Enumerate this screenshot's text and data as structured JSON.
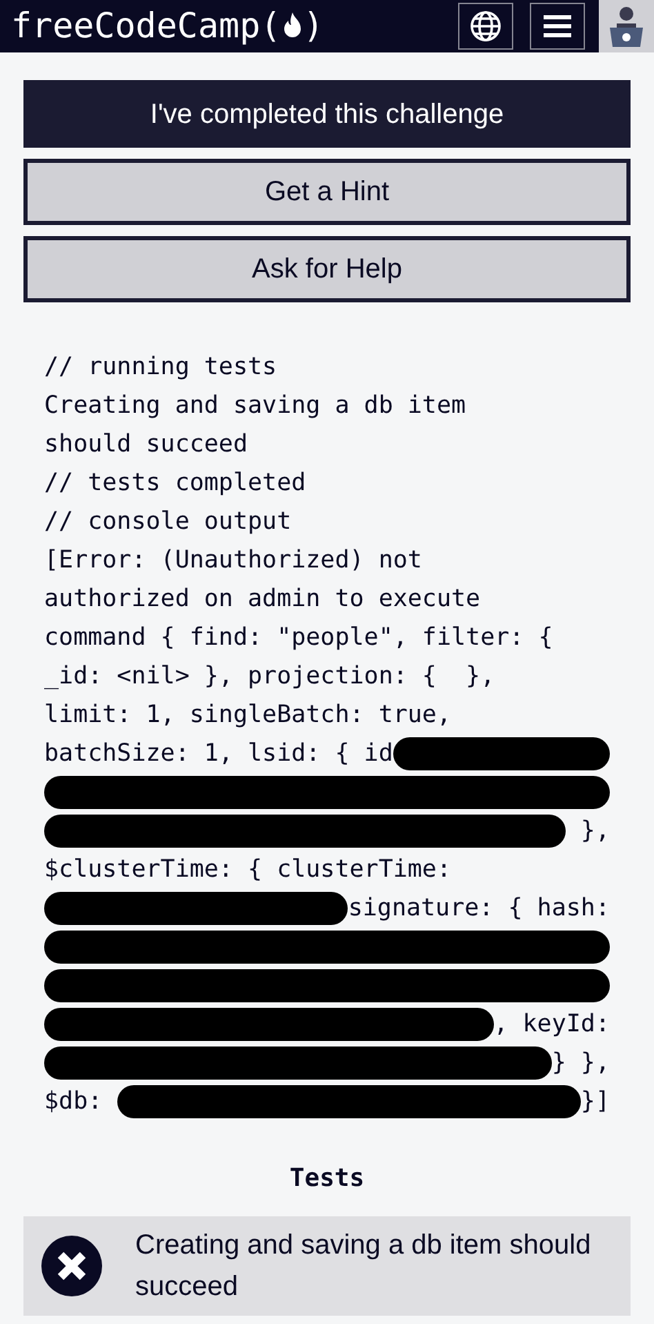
{
  "header": {
    "logo_before": "freeCodeCamp(",
    "logo_after": ")"
  },
  "actions": [
    {
      "label": "I've completed this challenge",
      "kind": "primary"
    },
    {
      "label": "Get a Hint",
      "kind": "secondary"
    },
    {
      "label": "Ask for Help",
      "kind": "secondary"
    }
  ],
  "console": [
    [
      {
        "kind": "text",
        "text": "// running tests"
      }
    ],
    [
      {
        "kind": "text",
        "text": "Creating and saving a db item"
      }
    ],
    [
      {
        "kind": "text",
        "text": "should succeed"
      }
    ],
    [
      {
        "kind": "text",
        "text": "// tests completed"
      }
    ],
    [
      {
        "kind": "text",
        "text": "// console output"
      }
    ],
    [
      {
        "kind": "text",
        "text": "[Error: (Unauthorized) not"
      }
    ],
    [
      {
        "kind": "text",
        "text": "authorized on admin to execute"
      }
    ],
    [
      {
        "kind": "text",
        "text": "command { find: \"people\", filter: {"
      }
    ],
    [
      {
        "kind": "text",
        "text": "_id: <nil> }, projection: {  },"
      }
    ],
    [
      {
        "kind": "text",
        "text": "limit: 1, singleBatch: true,"
      }
    ],
    [
      {
        "kind": "text",
        "text": "batchSize: 1, lsid: { id"
      },
      {
        "kind": "redaction"
      }
    ],
    [
      {
        "kind": "redaction"
      }
    ],
    [
      {
        "kind": "redaction"
      },
      {
        "kind": "text",
        "text": " },"
      }
    ],
    [
      {
        "kind": "text",
        "text": "$clusterTime: { clusterTime:"
      }
    ],
    [
      {
        "kind": "redaction"
      },
      {
        "kind": "text",
        "text": "signature: { hash:"
      }
    ],
    [
      {
        "kind": "redaction"
      }
    ],
    [
      {
        "kind": "redaction"
      }
    ],
    [
      {
        "kind": "redaction"
      },
      {
        "kind": "text",
        "text": ", keyId:"
      }
    ],
    [
      {
        "kind": "redaction"
      },
      {
        "kind": "text",
        "text": "} },"
      }
    ],
    [
      {
        "kind": "text",
        "text": "$db: "
      },
      {
        "kind": "redaction"
      },
      {
        "kind": "text",
        "text": "}]"
      }
    ]
  ],
  "tests": {
    "heading": "Tests",
    "items": [
      {
        "text": "Creating and saving a db item should succeed",
        "passed": false
      }
    ]
  }
}
